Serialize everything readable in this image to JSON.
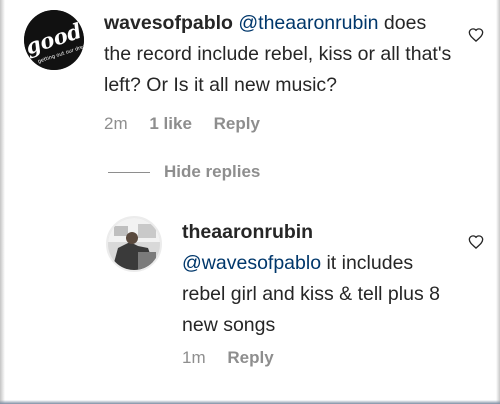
{
  "comment": {
    "username": "wavesofpablo",
    "mention": "@theaaronrubin",
    "text": " does the record include rebel, kiss or all that's left? Or Is it all new music?",
    "time": "2m",
    "likes": "1 like",
    "reply_label": "Reply",
    "avatar_icon": "good-logo-avatar",
    "avatar_text": {
      "main": "good",
      "sub": "getting out our dreams"
    }
  },
  "replies_toggle": {
    "label": "Hide replies"
  },
  "reply": {
    "username": "theaaronrubin",
    "mention": "@wavesofpablo",
    "text": " it includes rebel girl and kiss & tell plus 8 new songs",
    "time": "1m",
    "reply_label": "Reply",
    "avatar_icon": "profile-photo-avatar"
  },
  "colors": {
    "username": "#262626",
    "mention": "#00376b",
    "meta": "#8e8e8e"
  },
  "icons": {
    "like": "heart-outline-icon"
  }
}
